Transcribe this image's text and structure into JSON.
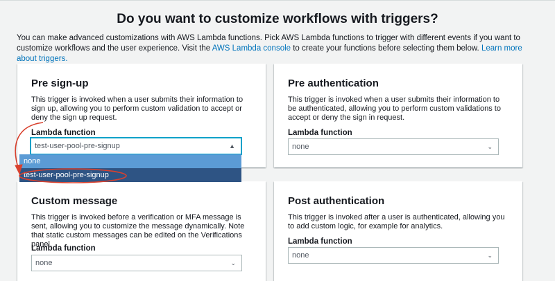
{
  "page": {
    "title": "Do you want to customize workflows with triggers?",
    "intro_before": "You can make advanced customizations with AWS Lambda functions. Pick AWS Lambda functions to trigger with different events if you want to customize workflows and the user experience. Visit the ",
    "console_link": "AWS Lambda console",
    "intro_middle": " to create your functions before selecting them below. ",
    "learn_link": "Learn more about triggers."
  },
  "cards": {
    "pre_signup": {
      "title": "Pre sign-up",
      "description": "This trigger is invoked when a user submits their information to sign up, allowing you to perform custom validation to accept or deny the sign up request.",
      "lambda_label": "Lambda function",
      "selected": "test-user-pool-pre-signup"
    },
    "pre_auth": {
      "title": "Pre authentication",
      "description": "This trigger is invoked when a user submits their information to be authenticated, allowing you to perform custom validations to accept or deny the sign in request.",
      "lambda_label": "Lambda function",
      "selected": "none"
    },
    "custom_message": {
      "title": "Custom message",
      "description": "This trigger is invoked before a verification or MFA message is sent, allowing you to customize the message dynamically. Note that static custom messages can be edited on the Verifications panel.",
      "lambda_label": "Lambda function",
      "selected": "none"
    },
    "post_auth": {
      "title": "Post authentication",
      "description": "This trigger is invoked after a user is authenticated, allowing you to add custom logic, for example for analytics.",
      "lambda_label": "Lambda function",
      "selected": "none"
    }
  },
  "dropdown": {
    "options": [
      "none",
      "test-user-pool-pre-signup"
    ]
  },
  "icons": {
    "open": "chevron-up-icon",
    "closed": "chevron-down-icon"
  },
  "colors": {
    "link": "#0073bb",
    "focus": "#00a1c9",
    "option_hover": "#5b9bd5",
    "option_selected": "#2e5484",
    "annotation": "#d9412e"
  }
}
